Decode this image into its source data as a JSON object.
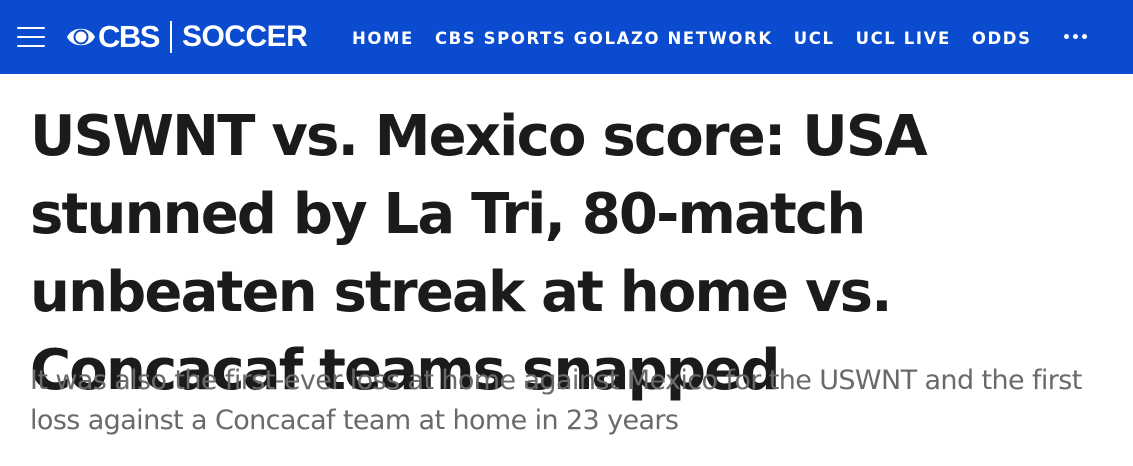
{
  "header": {
    "menu_icon": "hamburger-menu-icon",
    "logo": {
      "brand": "CBS",
      "section": "SOCCER",
      "icon": "cbs-eye-icon"
    },
    "nav_items": [
      {
        "label": "HOME"
      },
      {
        "label": "CBS SPORTS GOLAZO NETWORK"
      },
      {
        "label": "UCL"
      },
      {
        "label": "UCL LIVE"
      },
      {
        "label": "ODDS"
      }
    ],
    "more_icon": "more-horizontal-icon",
    "colors": {
      "bar": "#0a4bcf",
      "text": "#ffffff"
    }
  },
  "article": {
    "headline": "USWNT vs. Mexico score: USA stunned by La Tri, 80-match unbeaten streak at home vs. Concacaf teams snapped",
    "dek": "It was also the first-ever loss at home against Mexico for the USWNT and the first loss against a Concacaf team at home in 23 years",
    "colors": {
      "headline": "#1b1b1b",
      "dek": "#6a6a6a"
    }
  }
}
